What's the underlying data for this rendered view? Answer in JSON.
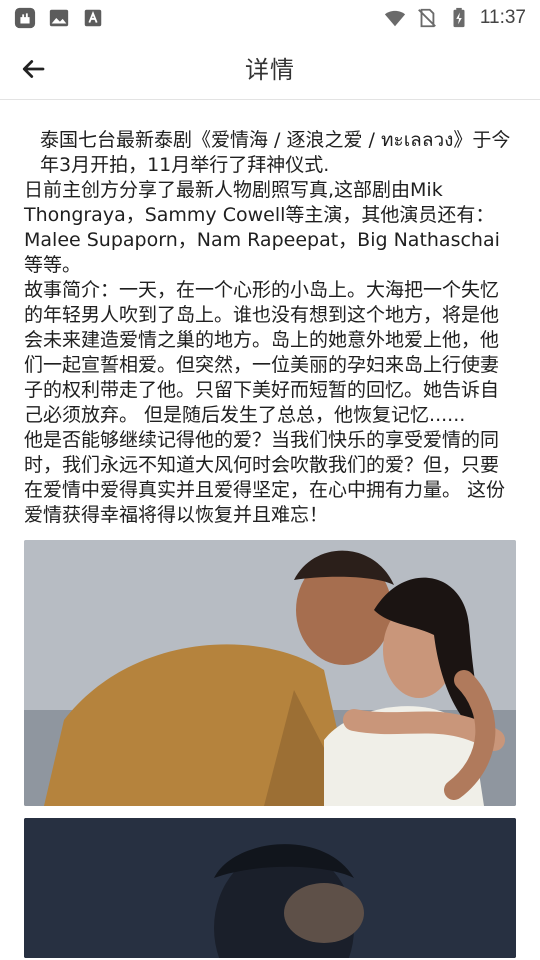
{
  "status": {
    "time": "11:37"
  },
  "header": {
    "title": "详情"
  },
  "article": {
    "paragraphs": [
      "泰国七台最新泰剧《爱情海 / 逐浪之爱 / ทะเลลวง》于今年3月开拍，11月举行了拜神仪式.",
      "日前主创方分享了最新人物剧照写真,这部剧由Mik Thongraya，Sammy Cowell等主演，其他演员还有：Malee Supaporn，Nam Rapeepat，Big Nathaschai等等。",
      "故事简介：一天，在一个心形的小岛上。大海把一个失忆的年轻男人吹到了岛上。谁也没有想到这个地方，将是他会未来建造爱情之巢的地方。岛上的她意外地爱上他，他们一起宣誓相爱。但突然，一位美丽的孕妇来岛上行使妻子的权利带走了他。只留下美好而短暂的回忆。她告诉自己必须放弃。 但是随后发生了总总，他恢复记忆......",
      "他是否能够继续记得他的爱？当我们快乐的享受爱情的同时，我们永远不知道大风何时会吹散我们的爱？但，只要在爱情中爱得真实并且爱得坚定，在心中拥有力量。 这份爱情获得幸福将得以恢复并且难忘！"
    ]
  }
}
